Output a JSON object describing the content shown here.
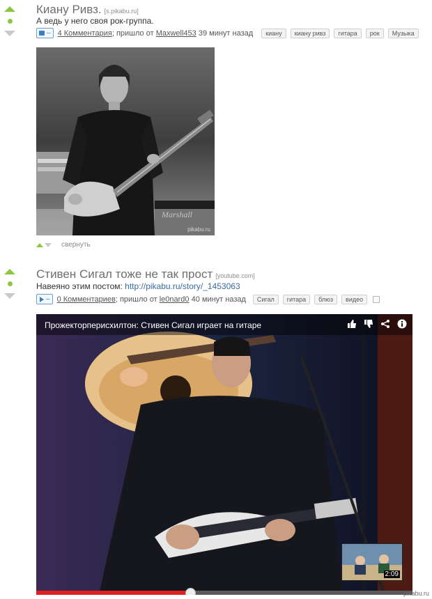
{
  "post1": {
    "title": "Киану Ривз.",
    "source": "[s.pikabu.ru]",
    "description": "А ведь у него своя рок-группа.",
    "comments": "4 Комментария",
    "posted_by_prefix": "; пришло от",
    "author": "Maxwell453",
    "time": "39 минут назад",
    "tags": [
      "киану",
      "киану ривз",
      "гитара",
      "рок",
      "Музыка"
    ],
    "image_watermark": "pikabu.ru",
    "collapse_label": "свернуть"
  },
  "post2": {
    "title": "Стивен Сигал тоже не так прост",
    "source": "[youtube.com]",
    "description_prefix": "Навеяно этим постом:",
    "description_link": "http://pikabu.ru/story/_1453063",
    "comments": "0 Комментариев",
    "posted_by_prefix": "; пришло от",
    "author": "le0nard0",
    "time": "40 минут назад",
    "tags": [
      "Сигал",
      "гитара",
      "блюз",
      "видео"
    ],
    "video": {
      "title": "Прожекторперисхилтон: Стивен Сигал играет на гитаре",
      "duration": "2:09",
      "progress_fraction": 0.41,
      "icons": [
        "thumb-up-icon",
        "thumb-down-icon",
        "share-icon",
        "info-icon"
      ]
    }
  },
  "footer_watermark": "pikabu.ru",
  "colors": {
    "vote_up": "#8dc63f",
    "vote_down": "#c9c9c9",
    "link": "#3a6aa0",
    "progress": "#e02020"
  }
}
